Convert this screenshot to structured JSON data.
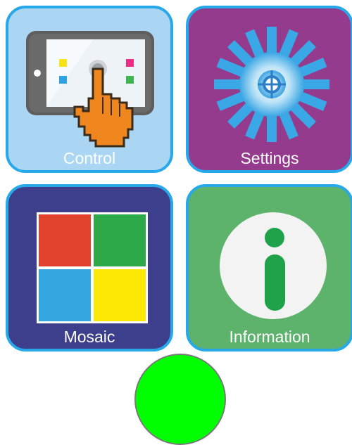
{
  "tiles": {
    "control": {
      "label": "Control",
      "background": "#aad6f4",
      "icon": "tablet-touch-icon"
    },
    "settings": {
      "label": "Settings",
      "background": "#943b8e",
      "icon": "gear-icon"
    },
    "mosaic": {
      "label": "Mosaic",
      "background": "#3d3f8c",
      "icon": "mosaic-grid-icon"
    },
    "information": {
      "label": "Information",
      "background": "#5db36b",
      "icon": "info-icon"
    }
  },
  "colors": {
    "tile_border": "#27a8e8",
    "status_indicator": "#00ff00",
    "mosaic_red": "#e2432c",
    "mosaic_green": "#2ea94a",
    "mosaic_blue": "#35a7e0",
    "mosaic_yellow": "#fbe805"
  },
  "status_indicator": {
    "state": "active",
    "color": "#00ff00"
  }
}
